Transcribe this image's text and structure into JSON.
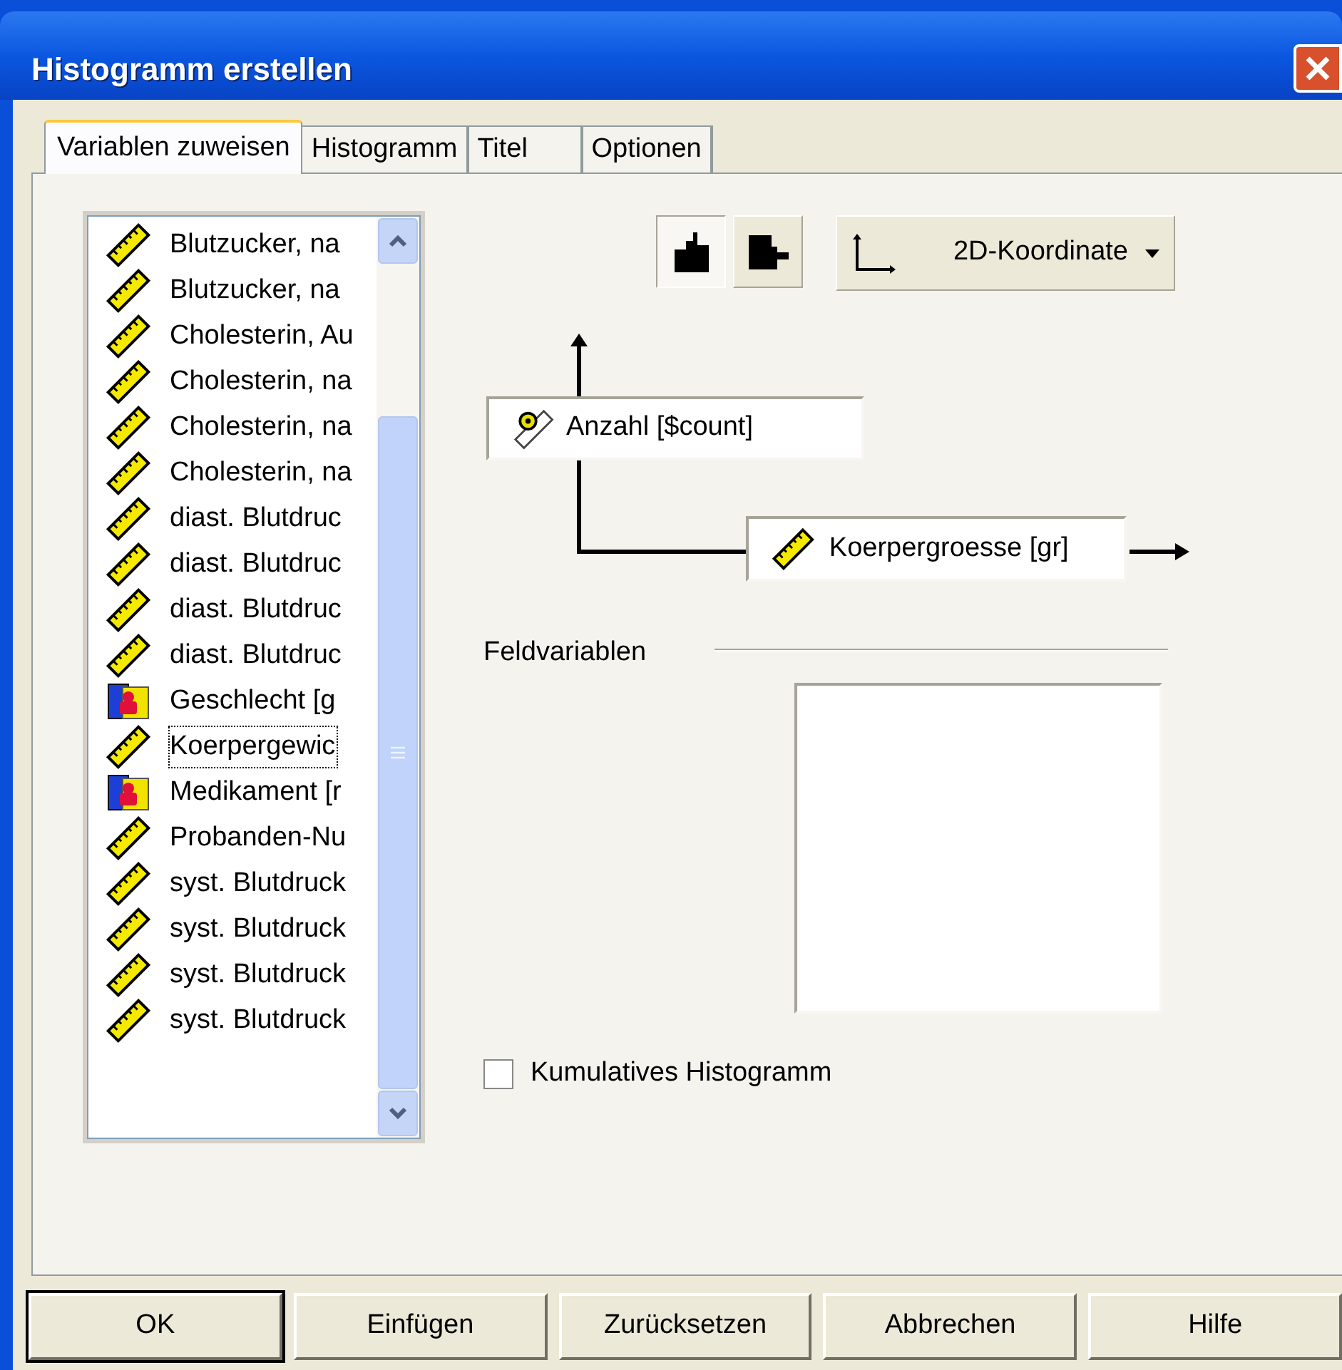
{
  "window": {
    "title": "Histogramm erstellen"
  },
  "tabs": [
    {
      "label": "Variablen zuweisen",
      "selected": true
    },
    {
      "label": "Histogramm",
      "selected": false
    },
    {
      "label": "Titel",
      "selected": false
    },
    {
      "label": "Optionen",
      "selected": false
    }
  ],
  "variables": [
    {
      "label": "Blutzucker, na",
      "kind": "scale",
      "selected": false
    },
    {
      "label": "Blutzucker, na",
      "kind": "scale",
      "selected": false
    },
    {
      "label": "Cholesterin, Au",
      "kind": "scale",
      "selected": false
    },
    {
      "label": "Cholesterin, na",
      "kind": "scale",
      "selected": false
    },
    {
      "label": "Cholesterin, na",
      "kind": "scale",
      "selected": false
    },
    {
      "label": "Cholesterin, na",
      "kind": "scale",
      "selected": false
    },
    {
      "label": "diast. Blutdruc",
      "kind": "scale",
      "selected": false
    },
    {
      "label": "diast. Blutdruc",
      "kind": "scale",
      "selected": false
    },
    {
      "label": "diast. Blutdruc",
      "kind": "scale",
      "selected": false
    },
    {
      "label": "diast. Blutdruc",
      "kind": "scale",
      "selected": false
    },
    {
      "label": "Geschlecht [g",
      "kind": "nominal",
      "selected": false
    },
    {
      "label": "Koerpergewic",
      "kind": "scale",
      "selected": true
    },
    {
      "label": "Medikament [r",
      "kind": "nominal",
      "selected": false
    },
    {
      "label": "Probanden-Nu",
      "kind": "scale",
      "selected": false
    },
    {
      "label": "syst. Blutdruck",
      "kind": "scale",
      "selected": false
    },
    {
      "label": "syst. Blutdruck",
      "kind": "scale",
      "selected": false
    },
    {
      "label": "syst. Blutdruck",
      "kind": "scale",
      "selected": false
    },
    {
      "label": "syst. Blutdruck",
      "kind": "scale",
      "selected": false
    }
  ],
  "orientation_buttons": [
    {
      "kind": "vertical",
      "selected": true
    },
    {
      "kind": "horizontal",
      "selected": false
    }
  ],
  "coordinate_dropdown": {
    "value": "2D-Koordinate"
  },
  "y_axis": {
    "label": "Anzahl [$count]"
  },
  "x_axis": {
    "label": "Koerpergroesse [gr]"
  },
  "panel_variables": {
    "label": "Feldvariablen"
  },
  "cumulative": {
    "label": "Kumulatives Histogramm",
    "checked": false
  },
  "buttons": [
    {
      "label": "OK",
      "default": true
    },
    {
      "label": "Einfügen",
      "default": false
    },
    {
      "label": "Zurücksetzen",
      "default": false
    },
    {
      "label": "Abbrechen",
      "default": false
    },
    {
      "label": "Hilfe",
      "default": false
    }
  ]
}
